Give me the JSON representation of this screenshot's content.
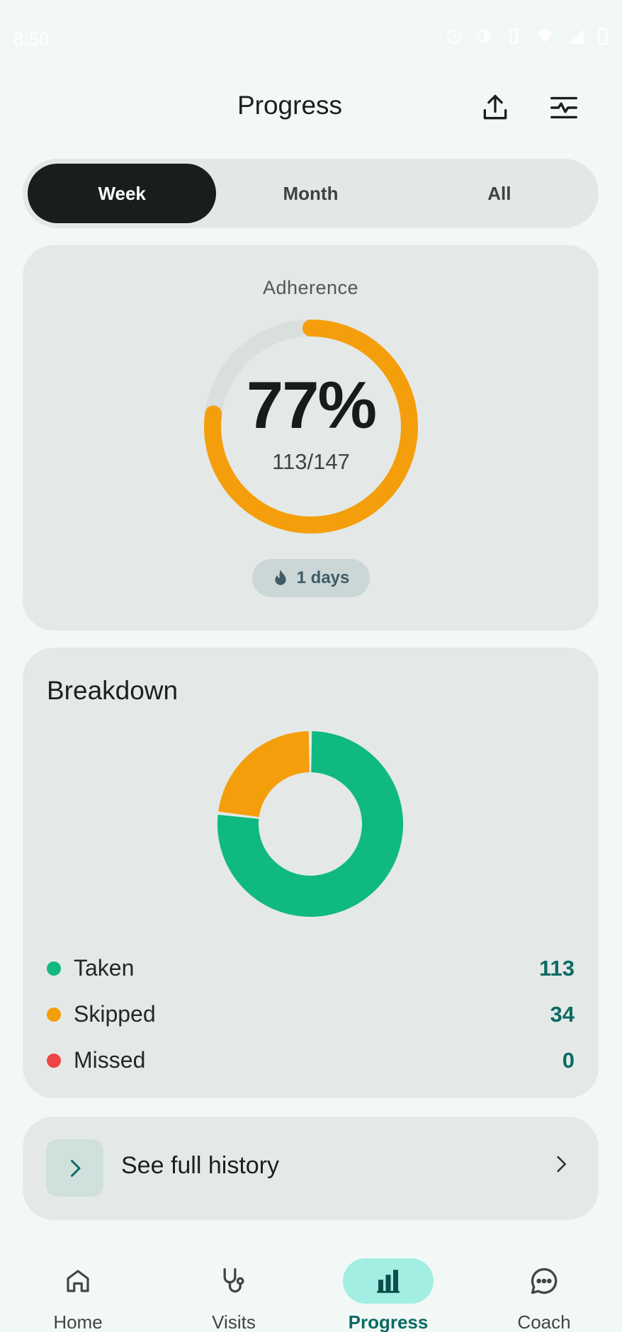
{
  "status_bar": {
    "time": "8:50",
    "icons": [
      "vpn-key-icon",
      "alarm-icon",
      "eye-comfort-icon",
      "vibrate-icon",
      "wifi-icon",
      "no-sim-icon",
      "signal-icon",
      "battery-icon"
    ]
  },
  "header": {
    "title": "Progress",
    "actions": [
      "share-export-icon",
      "health-report-icon"
    ]
  },
  "range_tabs": [
    {
      "label": "Week",
      "active": true
    },
    {
      "label": "Month",
      "active": false
    },
    {
      "label": "All",
      "active": false
    }
  ],
  "adherence": {
    "caption": "Adherence",
    "percent_text": "77%",
    "ratio_text": "113/147",
    "fraction": 0.77,
    "streak_text": "1 days",
    "ring_color": "#f59e0b",
    "track_color": "#d9dfdd"
  },
  "breakdown": {
    "title": "Breakdown",
    "items": [
      {
        "label": "Taken",
        "value": "113",
        "color": "#10b981"
      },
      {
        "label": "Skipped",
        "value": "34",
        "color": "#f59e0b"
      },
      {
        "label": "Missed",
        "value": "0",
        "color": "#ef4444"
      }
    ]
  },
  "history": {
    "label": "See full history"
  },
  "bottom_nav": [
    {
      "label": "Home",
      "icon": "home-icon",
      "active": false
    },
    {
      "label": "Visits",
      "icon": "stethoscope-icon",
      "active": false
    },
    {
      "label": "Progress",
      "icon": "bar-chart-icon",
      "active": true
    },
    {
      "label": "Coach",
      "icon": "chat-bubble-icon",
      "active": false
    }
  ],
  "colors": {
    "accent": "#0c6b64",
    "background": "#f1f8f6",
    "card": "#e4e9e7"
  }
}
